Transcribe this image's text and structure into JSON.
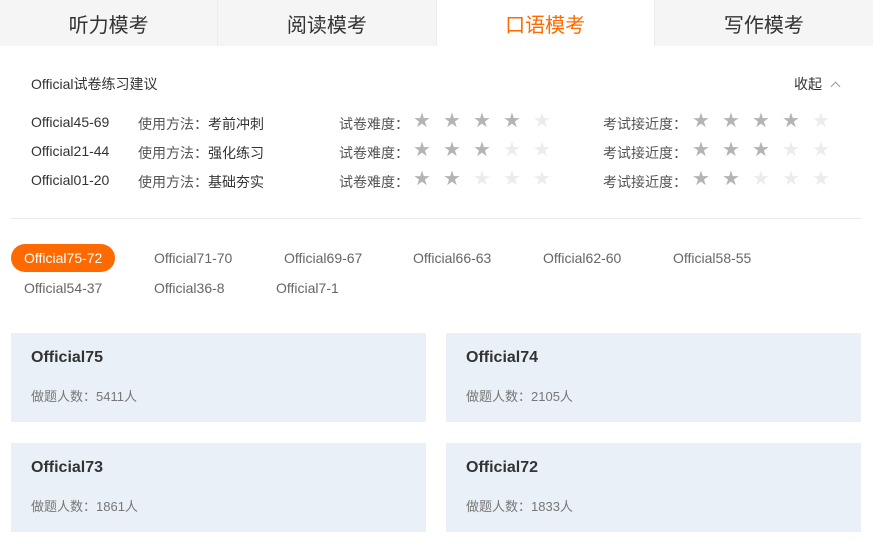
{
  "tabs": [
    {
      "label": "听力模考",
      "active": false
    },
    {
      "label": "阅读模考",
      "active": false
    },
    {
      "label": "口语模考",
      "active": true
    },
    {
      "label": "写作模考",
      "active": false
    }
  ],
  "colors": {
    "accent": "#ff6a00",
    "card_bg": "#eaf0f7",
    "star_on": "#b4b4b4",
    "star_off": "#ececec"
  },
  "advice": {
    "title": "Official试卷练习建议",
    "collapse_label": "收起",
    "method_prefix": "使用方法：",
    "difficulty_label": "试卷难度：",
    "closeness_label": "考试接近度：",
    "rows": [
      {
        "name": "Official45-69",
        "method": "考前冲刺",
        "difficulty": 4,
        "closeness": 4
      },
      {
        "name": "Official21-44",
        "method": "强化练习",
        "difficulty": 3,
        "closeness": 3
      },
      {
        "name": "Official01-20",
        "method": "基础夯实",
        "difficulty": 2,
        "closeness": 2
      }
    ],
    "max_stars": 5
  },
  "filters": [
    {
      "label": "Official75-72",
      "active": true
    },
    {
      "label": "Official71-70",
      "active": false
    },
    {
      "label": "Official69-67",
      "active": false
    },
    {
      "label": "Official66-63",
      "active": false
    },
    {
      "label": "Official62-60",
      "active": false
    },
    {
      "label": "Official58-55",
      "active": false
    },
    {
      "label": "Official54-37",
      "active": false
    },
    {
      "label": "Official36-8",
      "active": false
    },
    {
      "label": "Official7-1",
      "active": false
    }
  ],
  "cards": [
    {
      "title": "Official75",
      "stat": "做题人数：5411人"
    },
    {
      "title": "Official74",
      "stat": "做题人数：2105人"
    },
    {
      "title": "Official73",
      "stat": "做题人数：1861人"
    },
    {
      "title": "Official72",
      "stat": "做题人数：1833人"
    }
  ]
}
